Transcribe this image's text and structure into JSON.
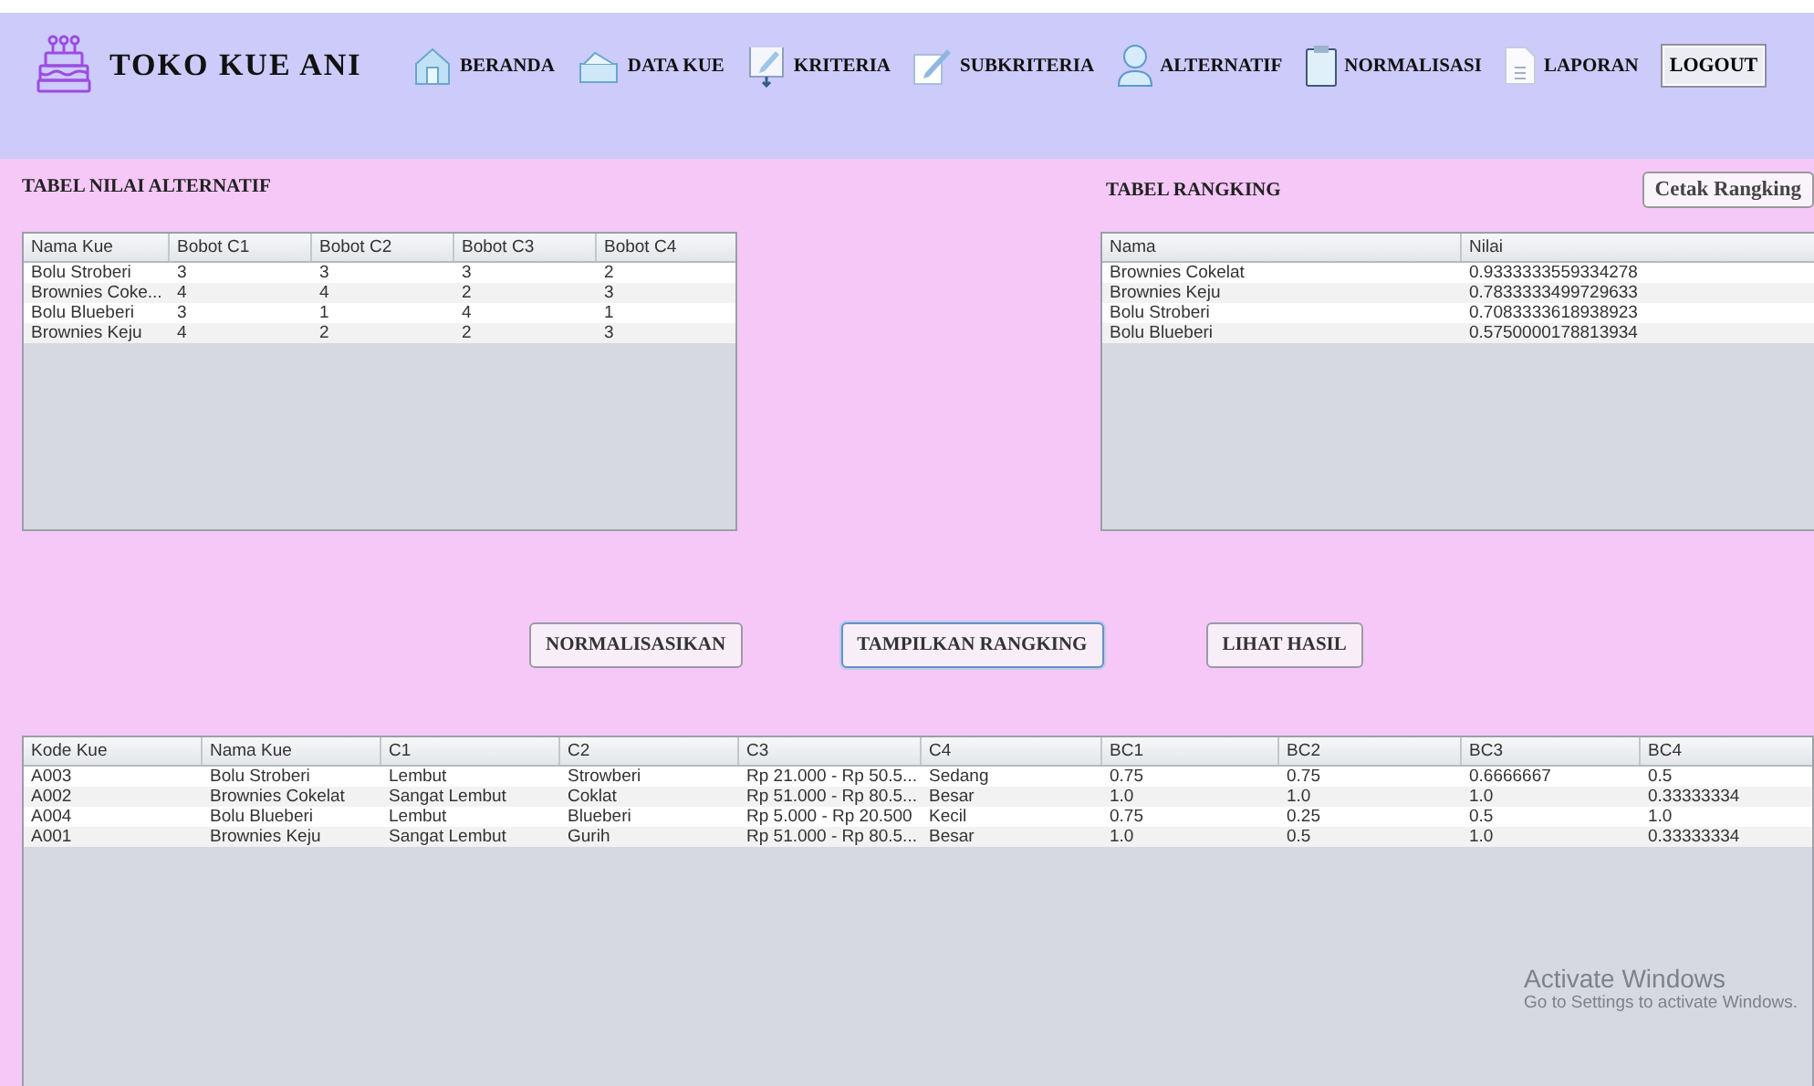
{
  "header": {
    "title": "TOKO KUE ANI",
    "nav": [
      {
        "label": "BERANDA"
      },
      {
        "label": "DATA KUE"
      },
      {
        "label": "KRITERIA"
      },
      {
        "label": "SUBKRITERIA"
      },
      {
        "label": "ALTERNATIF"
      },
      {
        "label": "NORMALISASI"
      },
      {
        "label": "LAPORAN"
      }
    ],
    "logout": "LOGOUT"
  },
  "alternatif_table": {
    "title": "TABEL NILAI ALTERNATIF",
    "columns": [
      "Nama Kue",
      "Bobot C1",
      "Bobot C2",
      "Bobot C3",
      "Bobot C4"
    ],
    "rows": [
      [
        "Bolu Stroberi",
        "3",
        "3",
        "3",
        "2"
      ],
      [
        "Brownies Coke...",
        "4",
        "4",
        "2",
        "3"
      ],
      [
        "Bolu Blueberi",
        "3",
        "1",
        "4",
        "1"
      ],
      [
        "Brownies Keju",
        "4",
        "2",
        "2",
        "3"
      ]
    ]
  },
  "ranking_table": {
    "title": "TABEL RANGKING",
    "print_button": "Cetak Rangking",
    "columns": [
      "Nama",
      "Nilai"
    ],
    "rows": [
      [
        "Brownies Cokelat",
        "0.9333333559334278"
      ],
      [
        "Brownies Keju",
        "0.7833333499729633"
      ],
      [
        "Bolu Stroberi",
        "0.7083333618938923"
      ],
      [
        "Bolu Blueberi",
        "0.5750000178813934"
      ]
    ]
  },
  "actions": [
    {
      "label": "NORMALISASIKAN",
      "focused": false
    },
    {
      "label": "TAMPILKAN RANGKING",
      "focused": true
    },
    {
      "label": "LIHAT HASIL",
      "focused": false
    }
  ],
  "result_table": {
    "columns": [
      "Kode Kue",
      "Nama Kue",
      "C1",
      "C2",
      "C3",
      "C4",
      "BC1",
      "BC2",
      "BC3",
      "BC4"
    ],
    "rows": [
      [
        "A003",
        "Bolu Stroberi",
        "Lembut",
        "Strowberi",
        "Rp 21.000 - Rp 50.5...",
        "Sedang",
        "0.75",
        "0.75",
        "0.6666667",
        "0.5"
      ],
      [
        "A002",
        "Brownies Cokelat",
        "Sangat Lembut",
        "Coklat",
        "Rp 51.000 - Rp 80.5...",
        "Besar",
        "1.0",
        "1.0",
        "1.0",
        "0.33333334"
      ],
      [
        "A004",
        "Bolu Blueberi",
        "Lembut",
        "Blueberi",
        "Rp 5.000 - Rp 20.500",
        "Kecil",
        "0.75",
        "0.25",
        "0.5",
        "1.0"
      ],
      [
        "A001",
        "Brownies Keju",
        "Sangat Lembut",
        "Gurih",
        "Rp 51.000 - Rp 80.5...",
        "Besar",
        "1.0",
        "0.5",
        "1.0",
        "0.33333334"
      ]
    ]
  },
  "os_notice": {
    "title": "Activate Windows",
    "subtitle": "Go to Settings to activate Windows."
  }
}
